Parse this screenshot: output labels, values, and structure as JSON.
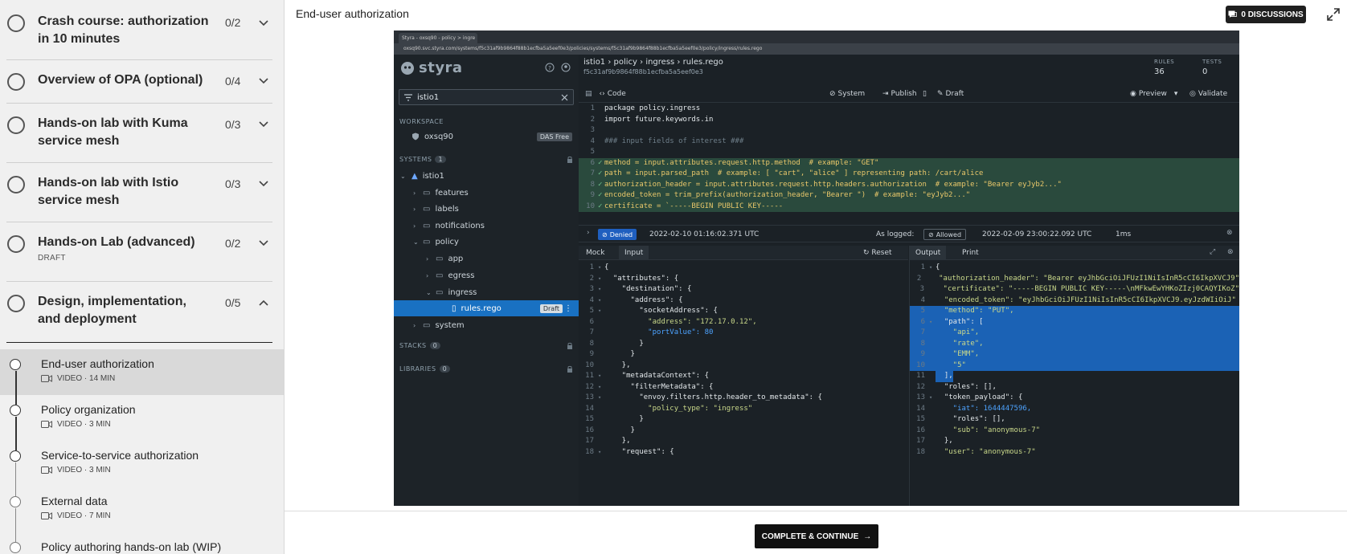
{
  "sidebar": {
    "chapters": [
      {
        "title": "Crash course: authorization in 10 minutes",
        "count": "0/2"
      },
      {
        "title": "Overview of OPA (optional)",
        "count": "0/4"
      },
      {
        "title": "Hands-on lab with Kuma service mesh",
        "count": "0/3"
      },
      {
        "title": "Hands-on lab with Istio service mesh",
        "count": "0/3"
      },
      {
        "title": "Hands-on Lab (advanced)",
        "count": "0/2",
        "sub": "DRAFT"
      },
      {
        "title": "Design, implementation, and deployment",
        "count": "0/5"
      }
    ],
    "lessons": [
      {
        "title": "End-user authorization",
        "meta": "VIDEO · 14 MIN"
      },
      {
        "title": "Policy organization",
        "meta": "VIDEO · 3 MIN"
      },
      {
        "title": "Service-to-service authorization",
        "meta": "VIDEO · 3 MIN"
      },
      {
        "title": "External data",
        "meta": "VIDEO · 7 MIN"
      },
      {
        "title": "Policy authoring hands-on lab (WIP)"
      }
    ]
  },
  "header": {
    "title": "End-user authorization",
    "discussions": "0 DISCUSSIONS"
  },
  "video": {
    "browser_tab": "Styra - oxsq90 - policy > ingre",
    "url": "oxsq90.svc.styra.com/systems/f5c31af9b9864f88b1ecfba5a5eef0e3/policies/systems/f5c31af9b9864f88b1ecfba5a5eef0e3/policy/ingress/rules.rego",
    "logo": "styra",
    "search_value": "istio1",
    "workspace_label": "WORKSPACE",
    "workspace_name": "oxsq90",
    "workspace_tag": "DAS Free",
    "systems_label": "SYSTEMS",
    "systems_count": "1",
    "tree": [
      {
        "label": "istio1"
      },
      {
        "label": "features"
      },
      {
        "label": "labels"
      },
      {
        "label": "notifications"
      },
      {
        "label": "policy"
      },
      {
        "label": "app"
      },
      {
        "label": "egress"
      },
      {
        "label": "ingress"
      },
      {
        "label": "rules.rego",
        "tag": "Draft"
      },
      {
        "label": "system"
      }
    ],
    "stacks_label": "STACKS",
    "stacks_count": "0",
    "libraries_label": "LIBRARIES",
    "libraries_count": "0",
    "breadcrumb": "istio1 › policy › ingress › rules.rego",
    "hash": "f5c31af9b9864f88b1ecfba5a5eef0e3",
    "rules_label": "RULES",
    "rules_value": "36",
    "tests_label": "TESTS",
    "tests_value": "0",
    "toolbar": {
      "code": "Code",
      "system": "System",
      "publish": "Publish",
      "draft": "Draft",
      "preview": "Preview",
      "validate": "Validate"
    },
    "code_lines": [
      {
        "n": "1",
        "t": "package policy.ingress"
      },
      {
        "n": "2",
        "t": "import future.keywords.in"
      },
      {
        "n": "3",
        "t": ""
      },
      {
        "n": "4",
        "t": "### input fields of interest ###"
      },
      {
        "n": "5",
        "t": ""
      },
      {
        "n": "6",
        "t": "method = input.attributes.request.http.method  # example: \"GET\""
      },
      {
        "n": "7",
        "t": "path = input.parsed_path  # example: [ \"cart\", \"alice\" ] representing path: /cart/alice"
      },
      {
        "n": "8",
        "t": "authorization_header = input.attributes.request.http.headers.authorization  # example: \"Bearer eyJyb2...\""
      },
      {
        "n": "9",
        "t": "encoded_token = trim_prefix(authorization_header, \"Bearer \")  # example: \"eyJyb2...\""
      },
      {
        "n": "10",
        "t": "certificate = `-----BEGIN PUBLIC KEY-----"
      }
    ],
    "decision": {
      "denied": "Denied",
      "denied_time": "2022-02-10 01:16:02.371 UTC",
      "as_logged": "As logged:",
      "allowed": "Allowed",
      "allowed_time": "2022-02-09 23:00:22.092 UTC",
      "duration": "1ms"
    },
    "input_tabs": {
      "mock": "Mock",
      "input": "Input",
      "reset": "Reset"
    },
    "output_tabs": {
      "output": "Output",
      "print": "Print"
    },
    "input_lines": [
      {
        "n": "1",
        "t": "{"
      },
      {
        "n": "2",
        "t": "  \"attributes\": {"
      },
      {
        "n": "3",
        "t": "    \"destination\": {"
      },
      {
        "n": "4",
        "t": "      \"address\": {"
      },
      {
        "n": "5",
        "t": "        \"socketAddress\": {"
      },
      {
        "n": "6",
        "t": "          \"address\": \"172.17.0.12\","
      },
      {
        "n": "7",
        "t": "          \"portValue\": 80"
      },
      {
        "n": "8",
        "t": "        }"
      },
      {
        "n": "9",
        "t": "      }"
      },
      {
        "n": "10",
        "t": "    },"
      },
      {
        "n": "11",
        "t": "    \"metadataContext\": {"
      },
      {
        "n": "12",
        "t": "      \"filterMetadata\": {"
      },
      {
        "n": "13",
        "t": "        \"envoy.filters.http.header_to_metadata\": {"
      },
      {
        "n": "14",
        "t": "          \"policy_type\": \"ingress\""
      },
      {
        "n": "15",
        "t": "        }"
      },
      {
        "n": "16",
        "t": "      }"
      },
      {
        "n": "17",
        "t": "    },"
      },
      {
        "n": "18",
        "t": "    \"request\": {"
      }
    ],
    "output_lines": [
      {
        "n": "1",
        "t": "{"
      },
      {
        "n": "2",
        "t": "  \"authorization_header\": \"Bearer eyJhbGciOiJFUzI1NiIsInR5cCI6IkpXVCJ9\""
      },
      {
        "n": "3",
        "t": "  \"certificate\": \"-----BEGIN PUBLIC KEY-----\\nMFkwEwYHKoZIzj0CAQYIKoZ\""
      },
      {
        "n": "4",
        "t": "  \"encoded_token\": \"eyJhbGciOiJFUzI1NiIsInR5cCI6IkpXVCJ9.eyJzdWIiOiJ\""
      },
      {
        "n": "5",
        "t": "  \"method\": \"PUT\","
      },
      {
        "n": "6",
        "t": "  \"path\": ["
      },
      {
        "n": "7",
        "t": "    \"api\","
      },
      {
        "n": "8",
        "t": "    \"rate\","
      },
      {
        "n": "9",
        "t": "    \"EMM\","
      },
      {
        "n": "10",
        "t": "    \"5\""
      },
      {
        "n": "11",
        "t": "  ],"
      },
      {
        "n": "12",
        "t": "  \"roles\": [],"
      },
      {
        "n": "13",
        "t": "  \"token_payload\": {"
      },
      {
        "n": "14",
        "t": "    \"iat\": 1644447596,"
      },
      {
        "n": "15",
        "t": "    \"roles\": [],"
      },
      {
        "n": "16",
        "t": "    \"sub\": \"anonymous-7\""
      },
      {
        "n": "17",
        "t": "  },"
      },
      {
        "n": "18",
        "t": "  \"user\": \"anonymous-7\""
      }
    ]
  },
  "footer": {
    "complete_label": "COMPLETE & CONTINUE"
  }
}
